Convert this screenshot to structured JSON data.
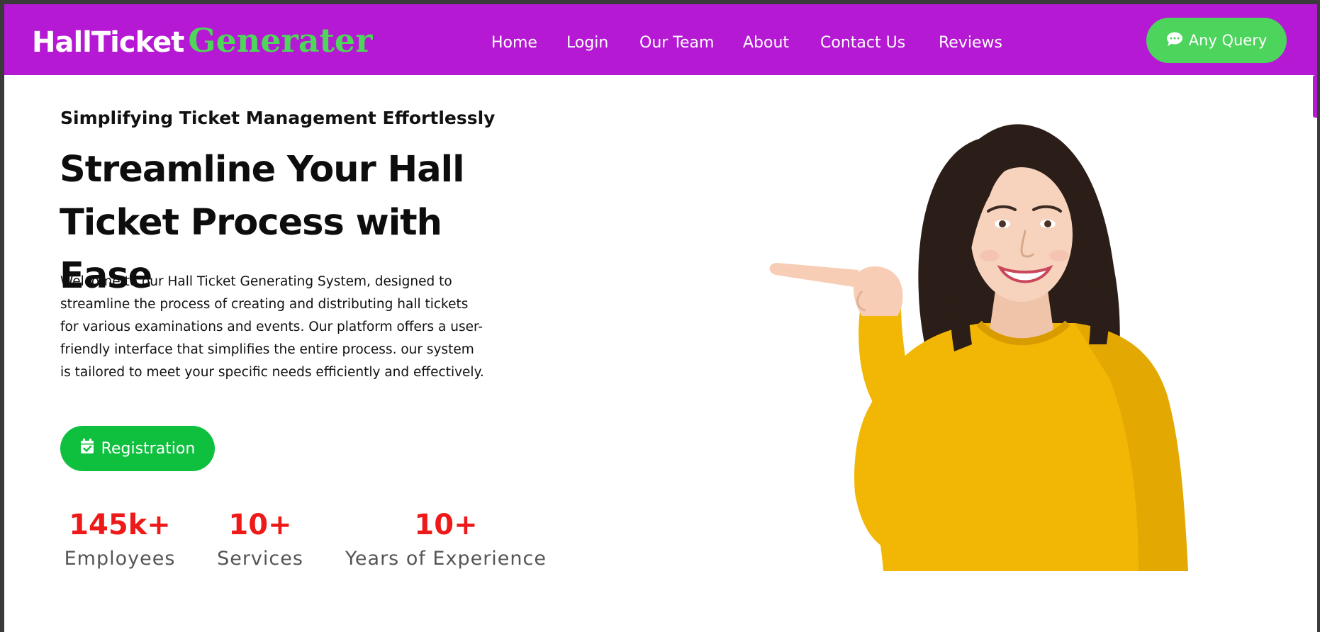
{
  "brand": {
    "main": "HallTicket",
    "accent": "Generater"
  },
  "nav": {
    "links": [
      "Home",
      "Login",
      "Our Team",
      "About",
      "Contact Us",
      "Reviews"
    ],
    "cta_label": "Any Query",
    "cta_icon": "chat-bubble-icon"
  },
  "hero": {
    "tagline": "Simplifying Ticket Management Effortlessly",
    "headline": "Streamline Your Hall Ticket Process with Ease",
    "intro": "Welcome to our Hall Ticket Generating System, designed to streamline the process of creating and distributing hall tickets for various examinations and events. Our platform offers a user-friendly interface that simplifies the entire process. our system is tailored to meet your specific needs efficiently and effectively.",
    "button_label": "Registration",
    "button_icon": "calendar-check-icon",
    "image": "woman-pointing-illustration"
  },
  "stats": [
    {
      "value": "145k+",
      "label": "Employees"
    },
    {
      "value": "10+",
      "label": "Services"
    },
    {
      "value": "10+",
      "label": "Years of Experience"
    }
  ],
  "colors": {
    "navbar": "#b519d3",
    "accent_green": "#4dd659",
    "button_green": "#0fc03e",
    "stat_red": "#ee1a1a"
  }
}
